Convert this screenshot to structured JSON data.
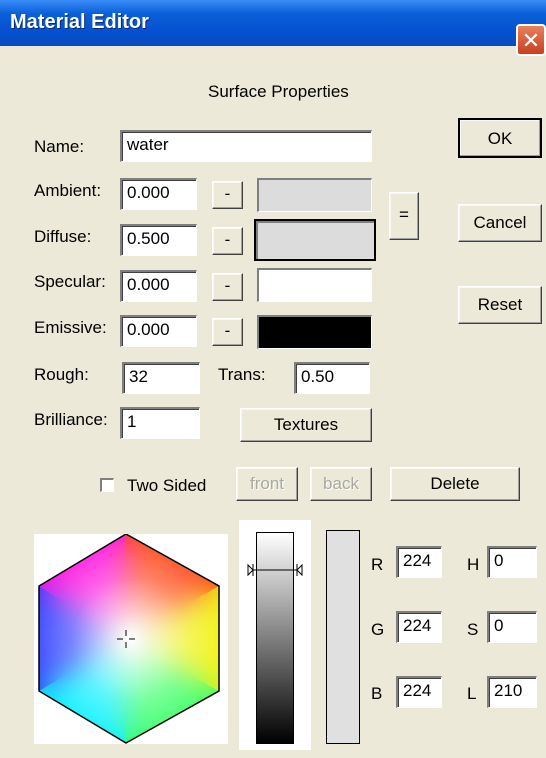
{
  "window": {
    "title": "Material Editor",
    "close_glyph": "✕"
  },
  "header": "Surface Properties",
  "name": {
    "label": "Name:",
    "value": "water"
  },
  "ambient": {
    "label": "Ambient:",
    "value": "0.000",
    "button": "-",
    "color": "#dcdcdc"
  },
  "diffuse": {
    "label": "Diffuse:",
    "value": "0.500",
    "button": "-",
    "color": "#dcdcdc"
  },
  "specular": {
    "label": "Specular:",
    "value": "0.000",
    "button": "-",
    "color": "#ffffff"
  },
  "emissive": {
    "label": "Emissive:",
    "value": "0.000",
    "button": "-",
    "color": "#000000"
  },
  "equal_button": "=",
  "rough": {
    "label": "Rough:",
    "value": "32"
  },
  "trans": {
    "label": "Trans:",
    "value": "0.50"
  },
  "brilliance": {
    "label": "Brilliance:",
    "value": "1"
  },
  "buttons": {
    "ok": "OK",
    "cancel": "Cancel",
    "reset": "Reset",
    "textures": "Textures",
    "front": "front",
    "back": "back",
    "delete": "Delete"
  },
  "two_sided": {
    "label": "Two Sided",
    "checked": false
  },
  "color": {
    "r_label": "R",
    "r": "224",
    "g_label": "G",
    "g": "224",
    "b_label": "B",
    "b": "224",
    "h_label": "H",
    "h": "0",
    "s_label": "S",
    "s": "0",
    "l_label": "L",
    "l": "210",
    "preview": "#e0e0e0",
    "luminance_fraction": 0.82
  }
}
